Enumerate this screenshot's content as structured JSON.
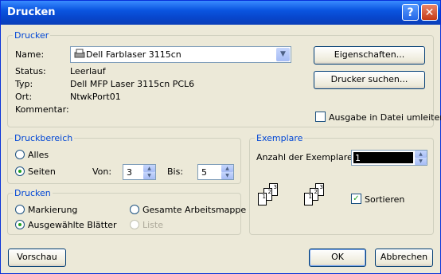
{
  "window": {
    "title": "Drucken",
    "help": "?",
    "close": "✕"
  },
  "printer": {
    "group": "Drucker",
    "name_label": "Name:",
    "name_value": "Dell Farblaser 3115cn",
    "status_label": "Status:",
    "status_value": "Leerlauf",
    "type_label": "Typ:",
    "type_value": "Dell MFP Laser 3115cn PCL6",
    "location_label": "Ort:",
    "location_value": "NtwkPort01",
    "comment_label": "Kommentar:",
    "properties_button": "Eigenschaften...",
    "find_button": "Drucker suchen...",
    "print_to_file": "Ausgabe in Datei umleiten"
  },
  "range": {
    "group": "Druckbereich",
    "all": "Alles",
    "pages": "Seiten",
    "from_label": "Von:",
    "from_value": "3",
    "to_label": "Bis:",
    "to_value": "5"
  },
  "print_what": {
    "group": "Drucken",
    "selection": "Markierung",
    "workbook": "Gesamte Arbeitsmappe",
    "sheets": "Ausgewählte Blätter",
    "list": "Liste"
  },
  "copies": {
    "group": "Exemplare",
    "count_label": "Anzahl der Exemplare:",
    "count_value": "1",
    "collate": "Sortieren"
  },
  "buttons": {
    "preview": "Vorschau",
    "ok": "OK",
    "cancel": "Abbrechen"
  }
}
